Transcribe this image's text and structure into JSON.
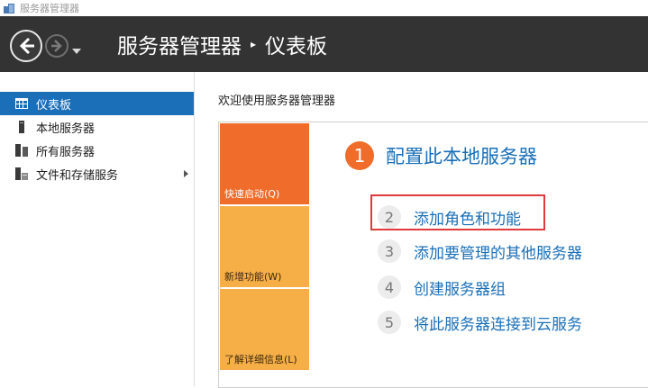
{
  "window": {
    "title": "服务器管理器"
  },
  "header": {
    "breadcrumb": [
      "服务器管理器",
      "仪表板"
    ],
    "separator": "▸"
  },
  "sidebar": {
    "items": [
      {
        "label": "仪表板",
        "icon": "dashboard-icon",
        "active": true
      },
      {
        "label": "本地服务器",
        "icon": "server-icon",
        "active": false
      },
      {
        "label": "所有服务器",
        "icon": "servers-icon",
        "active": false
      },
      {
        "label": "文件和存储服务",
        "icon": "storage-icon",
        "active": false,
        "has_submenu": true
      }
    ]
  },
  "main": {
    "welcome": "欢迎使用服务器管理器",
    "tiles": [
      {
        "label": "快速启动(Q)"
      },
      {
        "label": "新增功能(W)"
      },
      {
        "label": "了解详细信息(L)"
      }
    ],
    "steps": [
      {
        "num": "1",
        "label": "配置此本地服务器"
      },
      {
        "num": "2",
        "label": "添加角色和功能"
      },
      {
        "num": "3",
        "label": "添加要管理的其他服务器"
      },
      {
        "num": "4",
        "label": "创建服务器组"
      },
      {
        "num": "5",
        "label": "将此服务器连接到云服务"
      }
    ]
  },
  "colors": {
    "header_bg": "#333333",
    "accent_blue": "#1a6fb8",
    "tile_orange": "#ef6c2a",
    "tile_amber": "#f6ae46",
    "highlight_red": "#e0393e"
  }
}
